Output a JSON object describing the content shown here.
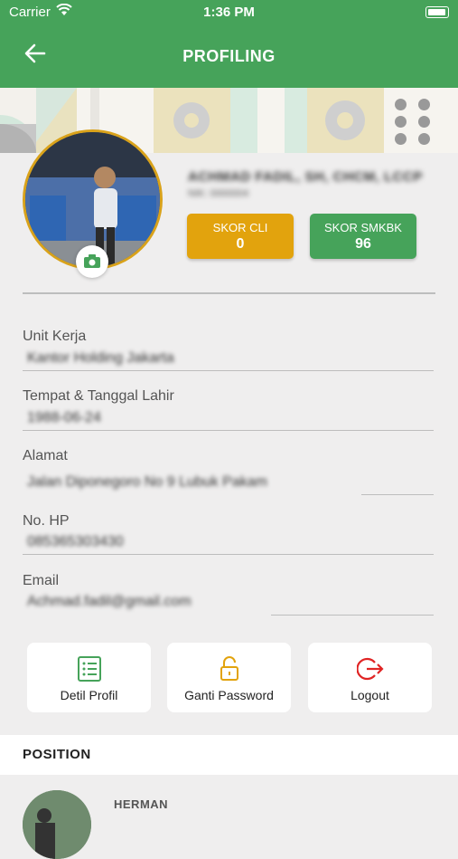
{
  "status_bar": {
    "carrier": "Carrier",
    "time": "1:36 PM"
  },
  "header": {
    "title": "PROFILING"
  },
  "profile": {
    "name": "ACHMAD FADIL, SH, CHCM, LCCP",
    "nik": "NIK: 0000004"
  },
  "scores": {
    "cli": {
      "label": "SKOR CLI",
      "value": "0",
      "color": "#e2a30d"
    },
    "smkbk": {
      "label": "SKOR SMKBK",
      "value": "96",
      "color": "#46a35a"
    }
  },
  "fields": {
    "unit_kerja": {
      "label": "Unit Kerja",
      "value": "Kantor Holding Jakarta"
    },
    "ttl": {
      "label": "Tempat & Tanggal Lahir",
      "value": "1988-06-24"
    },
    "alamat": {
      "label": "Alamat",
      "value": "Jalan Diponegoro No 9 Lubuk Pakam"
    },
    "hp": {
      "label": "No. HP",
      "value": "085365303430"
    },
    "email": {
      "label": "Email",
      "value": "Achmad.fadil@gmail.com"
    }
  },
  "actions": {
    "detil": {
      "label": "Detil Profil",
      "icon": "list-icon"
    },
    "password": {
      "label": "Ganti Password",
      "icon": "lock-open-icon"
    },
    "logout": {
      "label": "Logout",
      "icon": "logout-icon"
    }
  },
  "position": {
    "title": "POSITION",
    "member_name": "HERMAN"
  },
  "colors": {
    "brand": "#46a35a",
    "accent_yellow": "#e2a30d",
    "logout_red": "#e02424"
  }
}
